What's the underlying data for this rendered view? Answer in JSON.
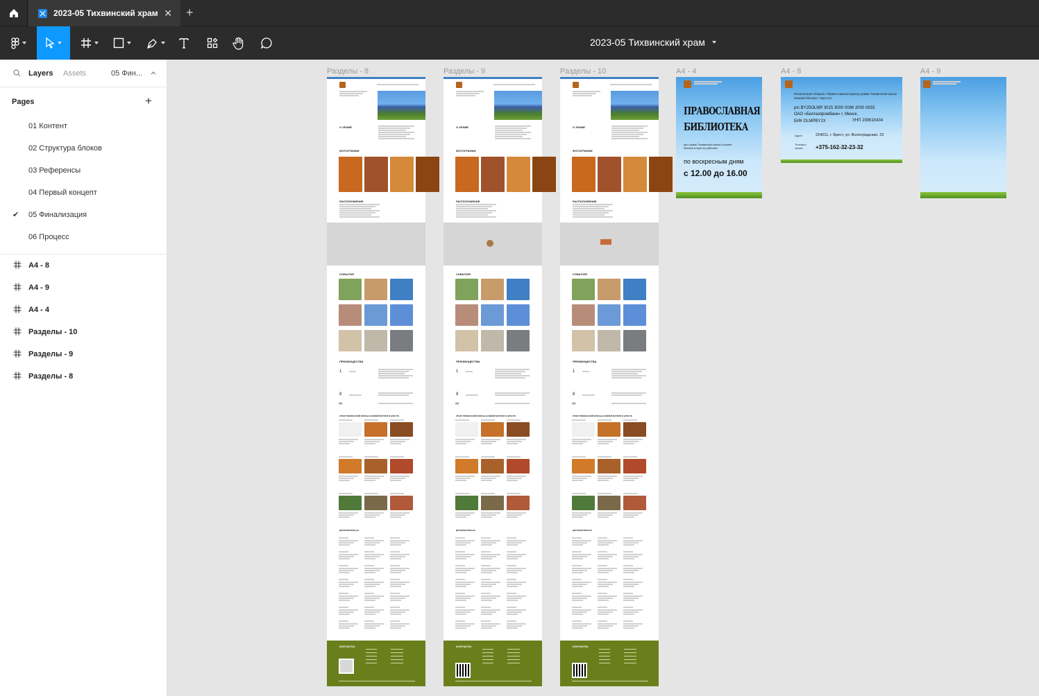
{
  "tabbar": {
    "file_tab": "2023-05 Тихвинский храм",
    "close": "✕",
    "new_tab": "+"
  },
  "toolbar": {
    "title": "2023-05 Тихвинский храм"
  },
  "left_panel": {
    "tabs": {
      "layers": "Layers",
      "assets": "Assets",
      "page_switch": "05 Фин..."
    },
    "pages_title": "Pages",
    "add_page": "+",
    "pages": [
      "01 Контент",
      "02 Структура блоков",
      "03 Референсы",
      "04 Первый концепт",
      "05 Финализация",
      "06 Процесс"
    ],
    "current_mark": "✔",
    "layers": [
      "A4 - 8",
      "A4 - 9",
      "A4 - 4",
      "Разделы - 10",
      "Разделы - 9",
      "Разделы - 8"
    ]
  },
  "canvas": {
    "frames": [
      "Разделы - 8",
      "Разделы - 9",
      "Разделы - 10",
      "A4 - 4",
      "A4 - 8",
      "A4 - 9"
    ],
    "site_section_about": "О ХРАМЕ",
    "site_section_photos": "ФОТОГРАФИИ",
    "site_section_location": "РАСПОЛОЖЕНИЕ",
    "site_section_events": "СОБЫТИЯ",
    "site_section_adv": "ПРЕИМУЩЕСТВА",
    "site_section_news": "ХРАМ ТИХВИНСКОЙ ИКОНЫ БОЖИЕЙ МАТЕРИ В БРЕСТЕ",
    "site_section_more": "ДОПОЛНИТЕЛЬНО",
    "site_section_contacts": "КОНТАКТЫ",
    "site_num_1": "1",
    "site_num_8": "8",
    "site_num_inf": "∞",
    "a4_4": {
      "title_line1": "ПРАВОСЛАВНАЯ",
      "title_line2": "БИБЛИОТЕКА",
      "sub": "при храме Тихвинской иконы Божией Матери в Бресте работает",
      "days": "по воскресным дням",
      "hours": "с 12.00 до 16.00"
    },
    "a4_8": {
      "header": "Религиозная община «Православный приход храма Тихвинской иконы Божией Матери г. Бреста»",
      "account": "р/с BY25OLMP 3015 3000 0096 2000 0933",
      "bank": "ОАО «Белгазпромбанк» г. Минск,",
      "bik": "БИК OLMPBY2X",
      "unp": "УНП 200610434",
      "addr_label": "Адрес",
      "addr": "224011, г. Брест, ул. Волгоградская, 23",
      "phone_label": "Телефон храма",
      "phone": "+375-162-32-23-32"
    }
  },
  "colors": {
    "accent": "#0d99ff",
    "dark": "#2c2c2c",
    "footer_green": "#6a7f1c"
  }
}
